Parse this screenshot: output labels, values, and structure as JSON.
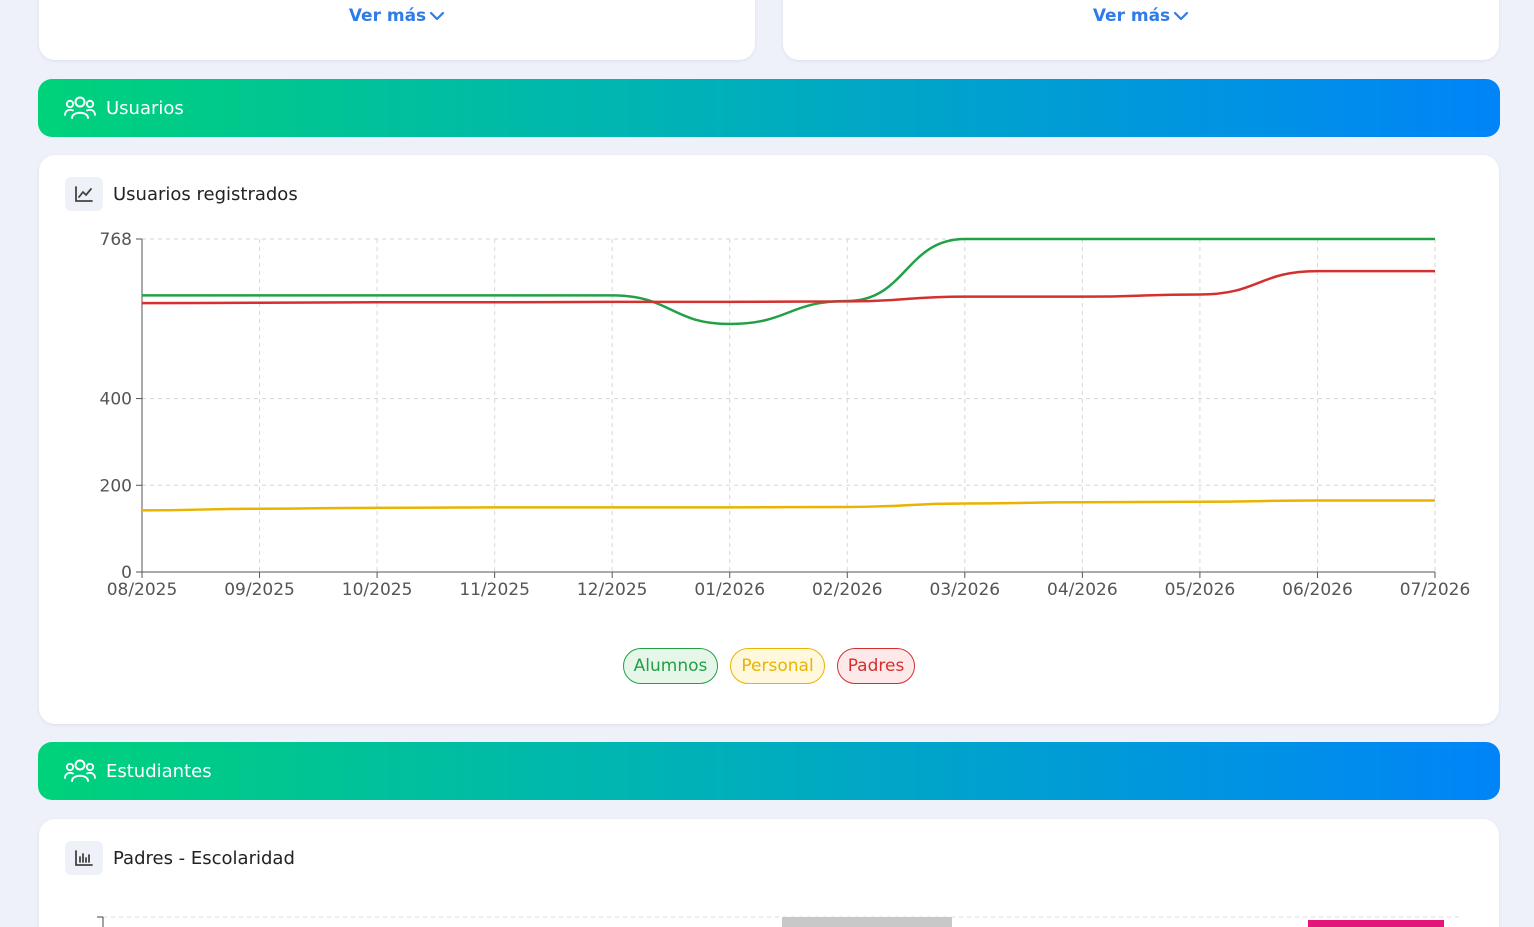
{
  "top_cards": {
    "left_link": "Ver más",
    "right_link": "Ver más"
  },
  "sections": {
    "usuarios": "Usuarios",
    "estudiantes": "Estudiantes"
  },
  "chart1": {
    "title": "Usuarios registrados",
    "chart_data": {
      "type": "line",
      "x": [
        "08/2025",
        "09/2025",
        "10/2025",
        "11/2025",
        "12/2025",
        "01/2026",
        "02/2026",
        "03/2026",
        "04/2026",
        "05/2026",
        "06/2026",
        "07/2026"
      ],
      "yticks": [
        0,
        200,
        400,
        768
      ],
      "ylim": [
        0,
        768
      ],
      "grid": true,
      "legend_placement": "bottom-center",
      "series": [
        {
          "name": "Alumnos",
          "color": "#22a046",
          "bg": "#e6f7ea",
          "values": [
            638,
            638,
            638,
            638,
            638,
            572,
            625,
            768,
            768,
            768,
            768,
            768
          ]
        },
        {
          "name": "Personal",
          "color": "#e8b400",
          "bg": "#fff8dc",
          "values": [
            142,
            146,
            148,
            149,
            149,
            149,
            150,
            158,
            161,
            162,
            165,
            165
          ]
        },
        {
          "name": "Padres",
          "color": "#d33030",
          "bg": "#fde9e9",
          "values": [
            620,
            621,
            622,
            622,
            623,
            623,
            624,
            635,
            635,
            640,
            694,
            694
          ]
        }
      ]
    }
  },
  "chart2": {
    "title": "Padres - Escolaridad"
  }
}
